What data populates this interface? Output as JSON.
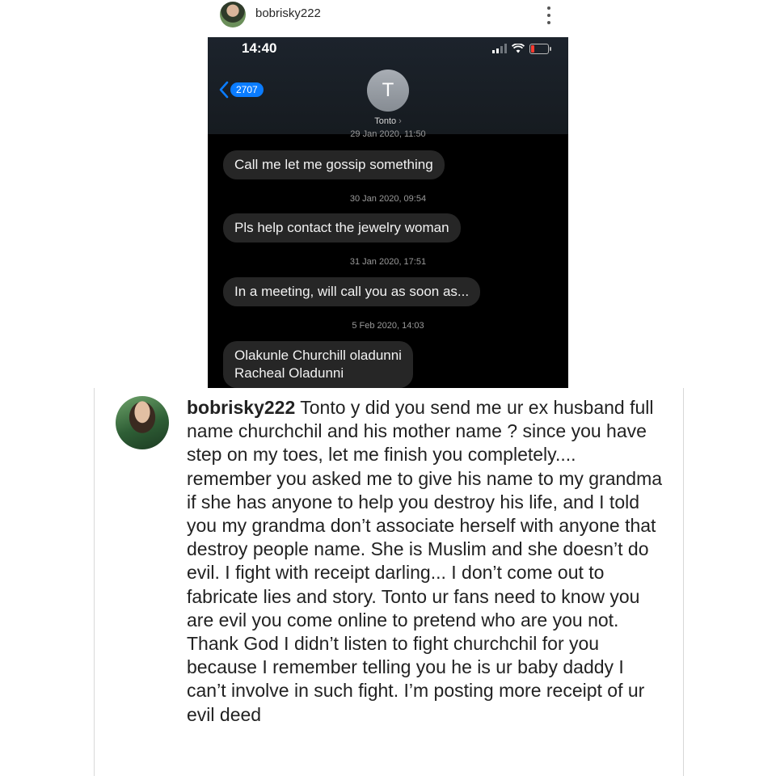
{
  "post": {
    "username": "bobrisky222"
  },
  "phone": {
    "time": "14:40",
    "back_badge": "2707",
    "contact_initial": "T",
    "contact_name": "Tonto",
    "messages": [
      {
        "stamp": "29 Jan 2020, 11:50",
        "lines": [
          "Call me let me gossip something"
        ]
      },
      {
        "stamp": "30 Jan 2020, 09:54",
        "lines": [
          "Pls help contact the jewelry woman"
        ]
      },
      {
        "stamp": "31 Jan 2020, 17:51",
        "lines": [
          "In a meeting, will call you as soon as..."
        ]
      },
      {
        "stamp": "5 Feb 2020, 14:03",
        "lines": [
          "Olakunle Churchill oladunni",
          "Racheal Oladunni"
        ]
      }
    ]
  },
  "comment": {
    "username": "bobrisky222",
    "text": "Tonto y did you send me ur ex husband full name churchchil and his mother name ? since you have step on my toes, let me finish you completely.... remember you asked me to give his name to my grandma if she has anyone to help you destroy his life, and I told you my grandma don’t associate herself with anyone that destroy people name. She is Muslim and she doesn’t do evil. I fight with receipt darling... I don’t come out to fabricate lies and story. Tonto ur fans need to know you are evil you come online to pretend who are you not. Thank God I didn’t listen to fight churchchil for you because I remember telling you he is ur baby daddy I can’t involve in such fight.  I’m posting more receipt of ur evil deed"
  },
  "icons": {
    "more": "more-vertical-icon",
    "back": "chevron-left-icon",
    "signal": "signal-icon",
    "wifi": "wifi-icon",
    "battery": "battery-low-icon"
  },
  "colors": {
    "ios_blue": "#0a7cff",
    "bubble": "#262626",
    "battery_low": "#ff3b30"
  }
}
